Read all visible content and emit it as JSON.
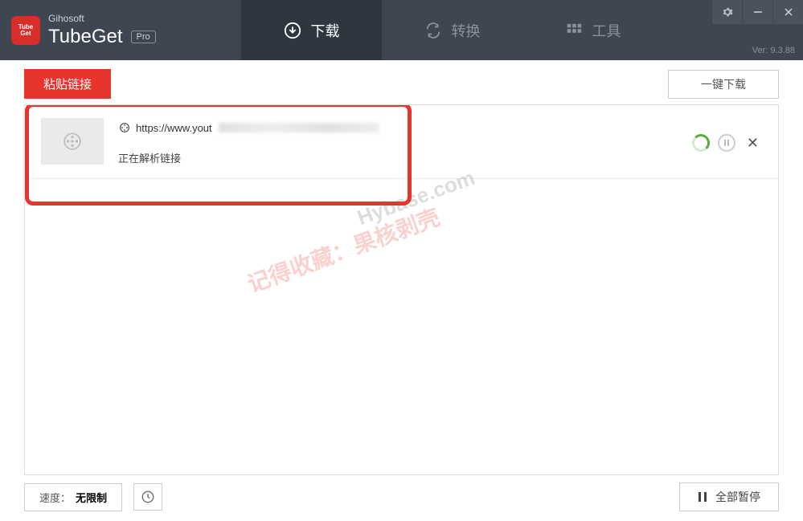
{
  "header": {
    "company": "Gihosoft",
    "app_name": "TubeGet",
    "pro_label": "Pro",
    "version": "Ver: 9.3.88"
  },
  "tabs": {
    "download": "下载",
    "convert": "转换",
    "tools": "工具"
  },
  "toolbar": {
    "paste_link": "粘贴链接",
    "download_all": "一键下载"
  },
  "item": {
    "url_prefix": "https://www.yout",
    "status": "正在解析链接"
  },
  "footer": {
    "speed_label": "速度：",
    "speed_value": "无限制",
    "pause_all": "全部暂停"
  },
  "watermarks": {
    "cn": "记得收藏：果核剥壳",
    "en": "Hybase.com"
  }
}
